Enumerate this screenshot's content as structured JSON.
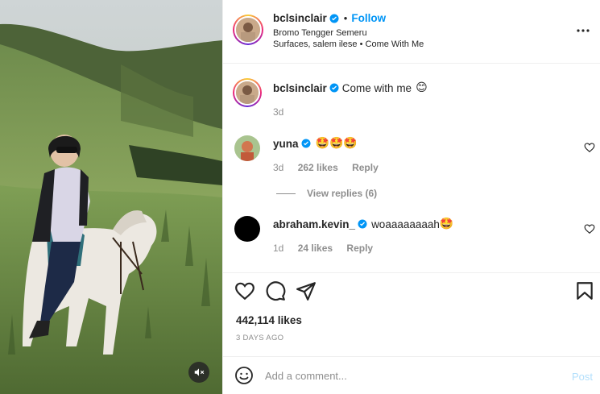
{
  "post": {
    "username": "bclsinclair",
    "follow_label": "Follow",
    "separator": "•",
    "location_line1": "Bromo Tengger Semeru",
    "location_line2": "Surfaces, salem ilese • Come With Me",
    "caption": {
      "username": "bclsinclair",
      "text": "Come with me",
      "emoji": "😊",
      "time": "3d"
    }
  },
  "comments": [
    {
      "username": "yuna",
      "text": "🤩🤩🤩",
      "time": "3d",
      "likes": "262 likes",
      "reply_label": "Reply",
      "view_replies": "View replies (6)"
    },
    {
      "username": "abraham.kevin_",
      "text": "woaaaaaaaah",
      "emoji": "🤩",
      "time": "1d",
      "likes": "24 likes",
      "reply_label": "Reply"
    }
  ],
  "stats": {
    "likes": "442,114 likes",
    "date": "3 DAYS AGO"
  },
  "composer": {
    "placeholder": "Add a comment...",
    "post_label": "Post"
  },
  "icons": {
    "verified": "verified-badge-icon",
    "more": "more-options-icon",
    "like": "heart-icon",
    "comment": "comment-icon",
    "share": "share-icon",
    "save": "bookmark-icon",
    "emoji": "emoji-icon",
    "mute": "muted-speaker-icon"
  },
  "colors": {
    "accent": "#0095f6",
    "post_disabled": "#b2dffc",
    "muted_text": "#8e8e8e"
  }
}
